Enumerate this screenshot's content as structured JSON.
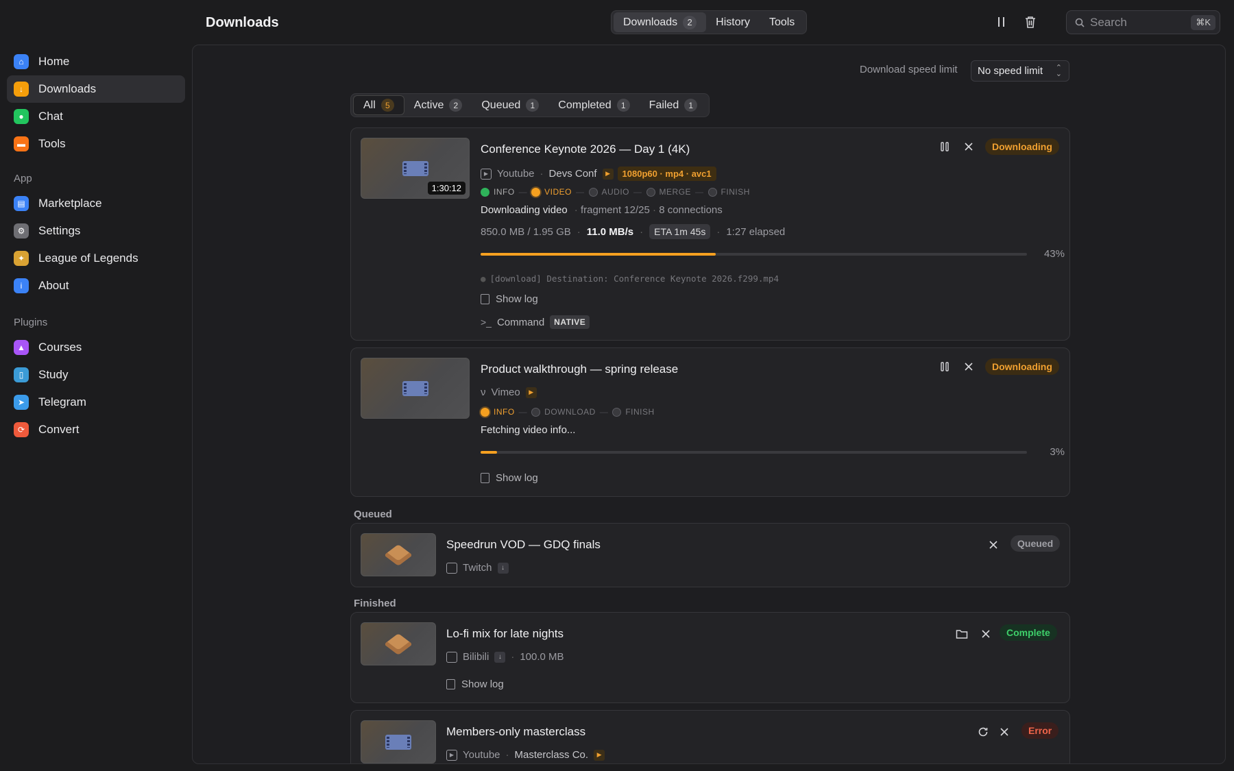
{
  "sidebar": {
    "items": [
      {
        "label": "Home",
        "color": "#3b82f6"
      },
      {
        "label": "Downloads",
        "color": "#f59e0b"
      },
      {
        "label": "Chat",
        "color": "#22c55e"
      },
      {
        "label": "Tools",
        "color": "#f97316"
      }
    ],
    "app_label": "App",
    "app_items": [
      {
        "label": "Marketplace",
        "color": "#3b82f6"
      },
      {
        "label": "Settings",
        "color": "#8e8e93"
      },
      {
        "label": "League of Legends",
        "color": "#d9a233"
      },
      {
        "label": "About",
        "color": "#3b82f6"
      }
    ],
    "plugins_label": "Plugins",
    "plugin_items": [
      {
        "label": "Courses",
        "color": "#a855f7"
      },
      {
        "label": "Study",
        "color": "#3b9bd6"
      },
      {
        "label": "Telegram",
        "color": "#3b9bea"
      },
      {
        "label": "Convert",
        "color": "#ef5a3c"
      }
    ]
  },
  "header": {
    "title": "Downloads",
    "tabs": [
      {
        "label": "Downloads",
        "count": "2"
      },
      {
        "label": "History"
      },
      {
        "label": "Tools"
      }
    ],
    "search_placeholder": "Search",
    "search_shortcut": "⌘K"
  },
  "toolbar": {
    "speed_label": "Download speed limit",
    "speed_value": "No speed limit"
  },
  "filters": [
    {
      "label": "All",
      "count": "5"
    },
    {
      "label": "Active",
      "count": "2"
    },
    {
      "label": "Queued",
      "count": "1"
    },
    {
      "label": "Completed",
      "count": "1"
    },
    {
      "label": "Failed",
      "count": "1"
    }
  ],
  "active": [
    {
      "title": "Conference Keynote 2026 — Day 1 (4K)",
      "duration": "1:30:12",
      "source": "Youtube",
      "channel": "Devs Conf",
      "format": "1080p60 · mp4 · avc1",
      "steps": [
        "INFO",
        "VIDEO",
        "AUDIO",
        "MERGE",
        "FINISH"
      ],
      "status": "Downloading video",
      "fragment": "fragment 12/25",
      "connections": "8 connections",
      "size": "850.0 MB / 1.95 GB",
      "speed": "11.0 MB/s",
      "eta": "ETA 1m 45s",
      "elapsed": "1:27 elapsed",
      "progress": 43,
      "progress_label": "43%",
      "log": "[download] Destination: Conference Keynote 2026.f299.mp4",
      "show_log": "Show log",
      "command": "Command",
      "command_tag": "NATIVE",
      "badge": "Downloading"
    },
    {
      "title": "Product walkthrough — spring release",
      "source": "Vimeo",
      "steps": [
        "INFO",
        "DOWNLOAD",
        "FINISH"
      ],
      "status": "Fetching video info...",
      "progress": 3,
      "progress_label": "3%",
      "show_log": "Show log",
      "badge": "Downloading"
    }
  ],
  "queued_label": "Queued",
  "queued": {
    "title": "Speedrun VOD — GDQ finals",
    "source": "Twitch",
    "badge": "Queued"
  },
  "finished_label": "Finished",
  "finished": {
    "title": "Lo-fi mix for late nights",
    "source": "Bilibili",
    "size": "100.0 MB",
    "show_log": "Show log",
    "badge": "Complete"
  },
  "failed": {
    "title": "Members-only masterclass",
    "source": "Youtube",
    "channel": "Masterclass Co.",
    "badge": "Error"
  }
}
